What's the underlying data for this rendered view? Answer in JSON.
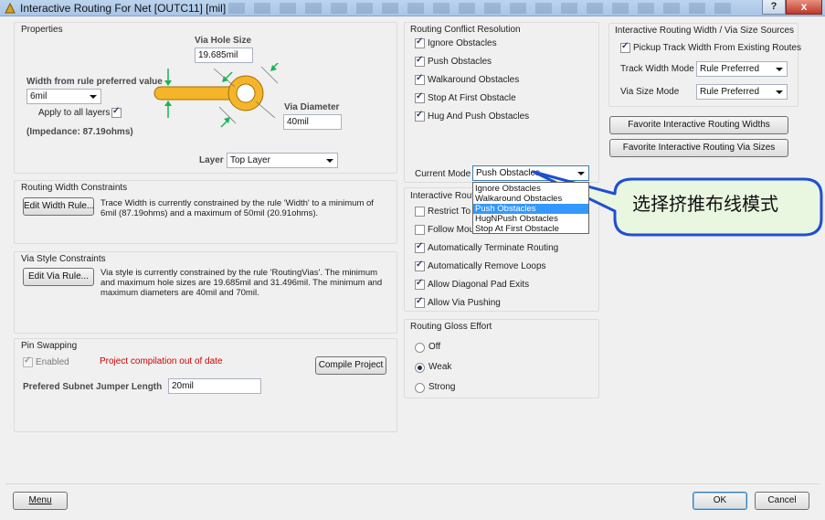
{
  "window": {
    "title": "Interactive Routing For Net [OUTC11] [mil]",
    "help_glyph": "?",
    "close_glyph": "x"
  },
  "properties": {
    "title": "Properties",
    "via_hole_size_label": "Via Hole Size",
    "via_hole_size_value": "19.685mil",
    "width_label": "Width from rule preferred value",
    "width_value": "6mil",
    "apply_all_layers_label": "Apply to all layers",
    "apply_all_layers_checked": true,
    "impedance": "(Impedance: 87.19ohms)",
    "via_diameter_label": "Via Diameter",
    "via_diameter_value": "40mil",
    "layer_label": "Layer",
    "layer_value": "Top Layer"
  },
  "routing_width": {
    "title": "Routing Width Constraints",
    "button": "Edit Width Rule...",
    "description": "Trace Width is currently constrained by the rule 'Width' to a minimum of 6mil (87.19ohms) and a maximum of 50mil (20.91ohms)."
  },
  "via_style": {
    "title": "Via Style Constraints",
    "button": "Edit Via Rule...",
    "description": "Via style is currently constrained by the rule 'RoutingVias'. The minimum and maximum hole sizes are 19.685mil and 31.496mil. The minimum and maximum diameters are 40mil and 70mil."
  },
  "pin_swapping": {
    "title": "Pin Swapping",
    "enabled_label": "Enabled",
    "enabled_checked": true,
    "warning": "Project compilation out of date",
    "compile_button": "Compile Project",
    "jumper_label": "Prefered Subnet Jumper Length",
    "jumper_value": "20mil"
  },
  "conflict": {
    "title": "Routing Conflict Resolution",
    "options": [
      {
        "label": "Ignore Obstacles",
        "checked": true
      },
      {
        "label": "Push Obstacles",
        "checked": true
      },
      {
        "label": "Walkaround Obstacles",
        "checked": true
      },
      {
        "label": "Stop At First Obstacle",
        "checked": true
      },
      {
        "label": "Hug And Push Obstacles",
        "checked": true
      }
    ],
    "current_mode_label": "Current Mode",
    "current_mode_value": "Push Obstacles",
    "dropdown_items": [
      "Ignore Obstacles",
      "Walkaround Obstacles",
      "Push Obstacles",
      "HugNPush Obstacles",
      "Stop At First Obstacle"
    ],
    "dropdown_selected_index": 2
  },
  "interactive_options": {
    "title": "Interactive Routin",
    "options": [
      {
        "label": "Restrict To 9",
        "checked": false
      },
      {
        "label": "Follow Mous",
        "checked": false
      },
      {
        "label": "Automatically Terminate Routing",
        "checked": true
      },
      {
        "label": "Automatically Remove Loops",
        "checked": true
      },
      {
        "label": "Allow Diagonal Pad Exits",
        "checked": true
      },
      {
        "label": "Allow Via Pushing",
        "checked": true
      }
    ]
  },
  "gloss": {
    "title": "Routing Gloss Effort",
    "options": [
      {
        "label": "Off",
        "selected": false
      },
      {
        "label": "Weak",
        "selected": true
      },
      {
        "label": "Strong",
        "selected": false
      }
    ]
  },
  "sources": {
    "title": "Interactive Routing Width / Via Size Sources",
    "pickup_label": "Pickup Track Width From Existing Routes",
    "pickup_checked": true,
    "track_mode_label": "Track Width Mode",
    "track_mode_value": "Rule Preferred",
    "via_mode_label": "Via Size Mode",
    "via_mode_value": "Rule Preferred",
    "fav_widths_button": "Favorite Interactive Routing Widths",
    "fav_vias_button": "Favorite Interactive Routing Via Sizes"
  },
  "callout": {
    "text": "选择挤推布线模式"
  },
  "footer": {
    "menu_button": "Menu",
    "ok_button": "OK",
    "cancel_button": "Cancel"
  },
  "colors": {
    "trace_orange": "#f5b52a",
    "dim_green": "#1db356",
    "callout_fill": "#e9f6e0",
    "callout_border": "#1f4fd0",
    "selection_blue": "#3399ff"
  }
}
